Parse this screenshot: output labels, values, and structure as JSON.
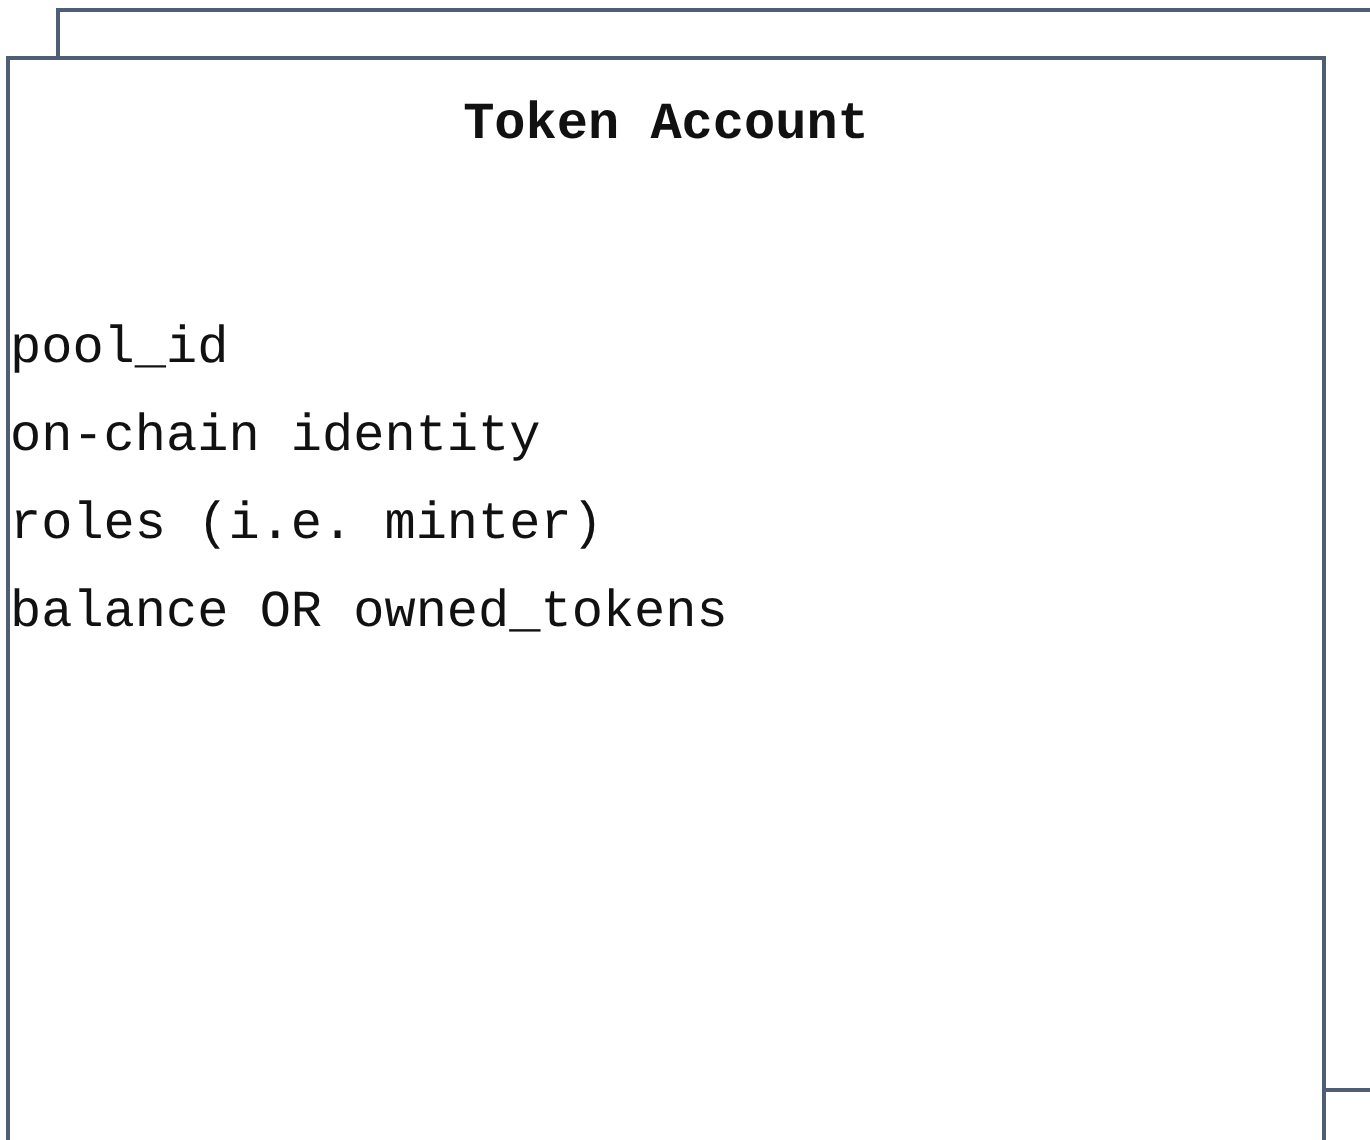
{
  "card": {
    "title": "Token Account",
    "fields": [
      "pool_id",
      "on-chain identity",
      "roles (i.e. minter)",
      "balance OR owned_tokens"
    ]
  }
}
